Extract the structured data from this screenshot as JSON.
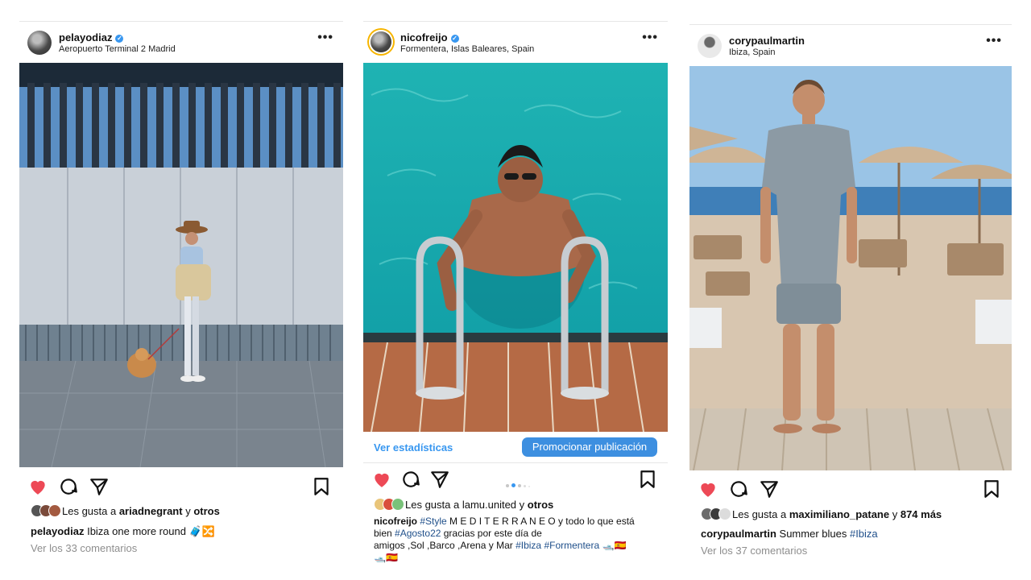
{
  "posts": [
    {
      "username": "pelayodiaz",
      "verified": true,
      "location": "Aeropuerto Terminal 2 Madrid",
      "more": "•••",
      "likes_prefix": "Les gusta a ",
      "likes_user": "ariadnegrant",
      "likes_mid": " y ",
      "likes_suffix": "otros",
      "caption_user": "pelayodiaz",
      "caption_text": " Ibiza one more round 🧳🔀",
      "comments": "Ver los 33 comentarios"
    },
    {
      "username": "nicofreijo",
      "verified": true,
      "location": "Formentera, Islas Baleares, Spain",
      "more": "•••",
      "stats_link": "Ver estadísticas",
      "promote_button": "Promocionar publicación",
      "likes_prefix": "Les gusta a ",
      "likes_user": "lamu.united",
      "likes_mid": " y ",
      "likes_suffix": "otros",
      "caption_user": "nicofreijo",
      "caption_tag1": "#Style",
      "caption_l1_rest": " M E D I T E R R A N E O y todo lo que está",
      "caption_l2_a": "bien ",
      "caption_tag2": "#Agosto22",
      "caption_l2_b": " gracias por este día de",
      "caption_l3_a": "amigos ,Sol ,Barco ,Arena y Mar ",
      "caption_tag3": "#Ibiza",
      "caption_tag4": "#Formentera",
      "caption_l3_emoji": "🛥️🇪🇸",
      "caption_l4_emoji": "🛥️🇪🇸"
    },
    {
      "username": "corypaulmartin",
      "verified": false,
      "location": "Ibiza, Spain",
      "more": "•••",
      "likes_prefix": "Les gusta a ",
      "likes_user": "maximiliano_patane",
      "likes_mid": " y ",
      "likes_suffix": "874 más",
      "caption_user": "corypaulmartin",
      "caption_text": " Summer blues ",
      "caption_tag": "#Ibiza",
      "comments": "Ver los 37 comentarios"
    }
  ],
  "colors": {
    "heart": "#ed4956",
    "link_blue": "#3897f0",
    "promote_bg": "#3d8fe0",
    "hashtag": "#1f4f8a",
    "muted": "#8e8e8e"
  },
  "icons": [
    "heart-filled-icon",
    "comment-icon",
    "share-icon",
    "bookmark-icon",
    "verified-icon",
    "more-icon"
  ]
}
